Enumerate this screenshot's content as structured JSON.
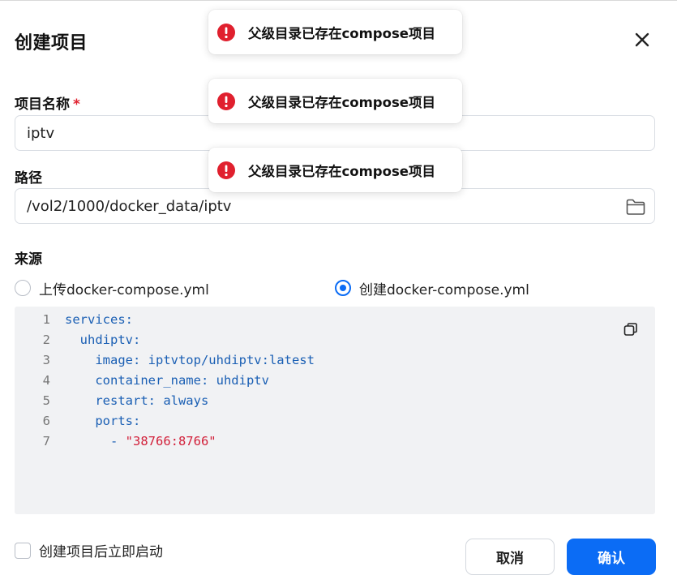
{
  "dialog": {
    "title": "创建项目"
  },
  "project_name": {
    "label": "项目名称",
    "required_mark": "*",
    "value": "iptv"
  },
  "path": {
    "label": "路径",
    "value": "/vol2/1000/docker_data/iptv"
  },
  "source": {
    "label": "来源",
    "options": [
      {
        "label": "上传docker-compose.yml",
        "selected": false
      },
      {
        "label": "创建docker-compose.yml",
        "selected": true
      }
    ]
  },
  "editor": {
    "lines": [
      {
        "num": "1",
        "text": "services:"
      },
      {
        "num": "2",
        "text": "  uhdiptv:"
      },
      {
        "num": "3",
        "text": "    image: iptvtop/uhdiptv:latest"
      },
      {
        "num": "4",
        "text": "    container_name: uhdiptv"
      },
      {
        "num": "5",
        "text": "    restart: always"
      },
      {
        "num": "6",
        "text": "    ports:"
      },
      {
        "num": "7",
        "prefix": "      - ",
        "string": "\"38766:8766\""
      }
    ]
  },
  "start_after_create": {
    "label": "创建项目后立即启动",
    "checked": false
  },
  "buttons": {
    "cancel": "取消",
    "confirm": "确认"
  },
  "toasts": [
    {
      "message": "父级目录已存在compose项目"
    },
    {
      "message": "父级目录已存在compose项目"
    },
    {
      "message": "父级目录已存在compose项目"
    }
  ],
  "colors": {
    "accent": "#0b6cf5",
    "error": "#e0202e",
    "code_key": "#1a5fb4",
    "code_string": "#d2203a",
    "editor_bg": "#f1f2f4"
  },
  "icons": {
    "close": "close-icon",
    "folder": "folder-icon",
    "copy": "copy-icon",
    "toast": "error-circle-icon"
  }
}
